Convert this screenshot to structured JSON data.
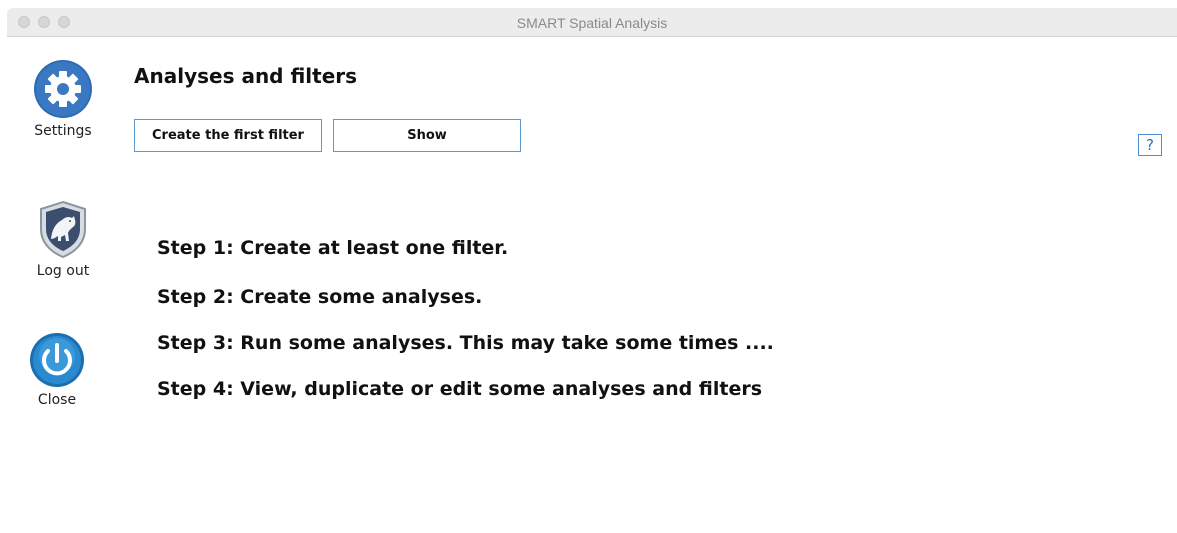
{
  "window": {
    "title": "SMART Spatial Analysis"
  },
  "sidebar": {
    "settings": {
      "label": "Settings",
      "icon": "gear-icon"
    },
    "logout": {
      "label": "Log out",
      "icon": "shield-panther-icon"
    },
    "close": {
      "label": "Close",
      "icon": "power-icon"
    }
  },
  "main": {
    "title": "Analyses and filters",
    "buttons": {
      "create_label": "Create the first filter",
      "show_label": "Show"
    },
    "help_label": "?",
    "steps": [
      "Step 1: Create at least one filter.",
      "Step 2: Create some analyses.",
      "Step 3: Run some analyses. This may take some times ....",
      "Step 4: View, duplicate or edit some analyses and filters"
    ]
  },
  "colors": {
    "accent_blue": "#2b6cb0",
    "button_border": "#5b9bd5",
    "power_blue": "#1f7fc4"
  }
}
